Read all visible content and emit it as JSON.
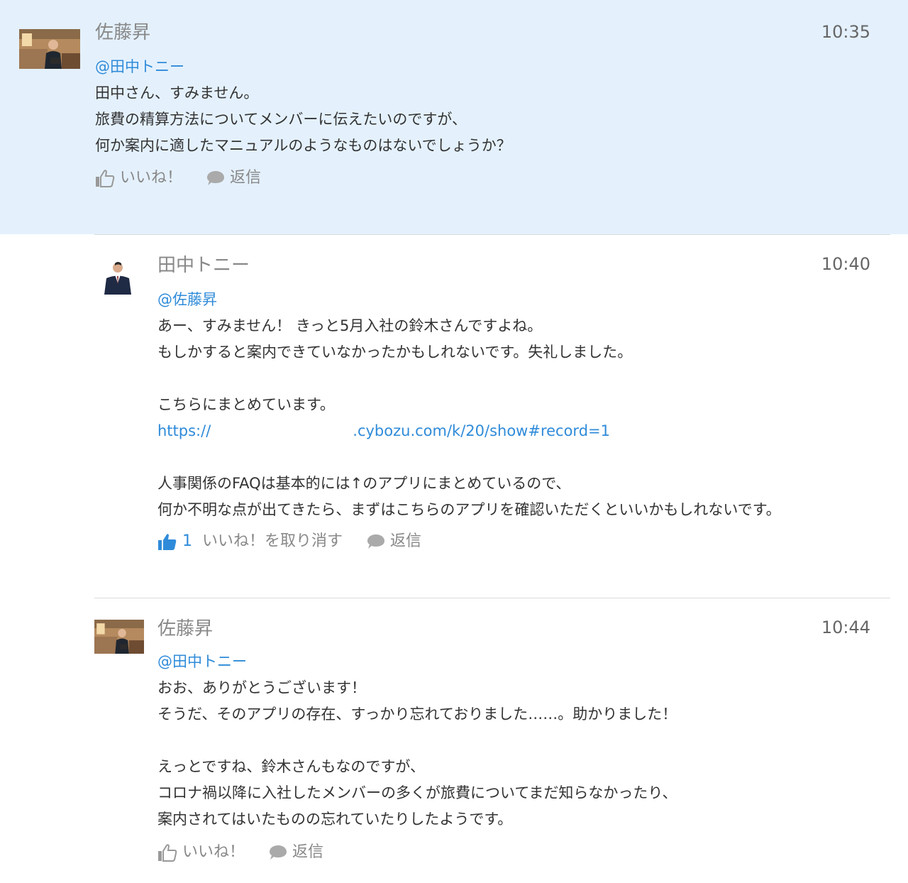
{
  "thread": {
    "root": {
      "author": "佐藤昇",
      "time": "10:35",
      "mention": "@田中トニー",
      "lines": [
        "田中さん、すみません。",
        "旅費の精算方法についてメンバーに伝えたいのですが、",
        "何か案内に適したマニュアルのようなものはないでしょうか？"
      ],
      "like_label": "いいね！",
      "reply_label": "返信"
    },
    "reply1": {
      "author": "田中トニー",
      "time": "10:40",
      "mention": "@佐藤昇",
      "lines_a": [
        "あー、すみません！ きっと5月入社の鈴木さんですよね。",
        "もしかすると案内できていなかったかもしれないです。失礼しました。",
        "",
        "こちらにまとめています。"
      ],
      "link_prefix": "https://",
      "link_suffix": ".cybozu.com/k/20/show#record=1",
      "lines_b": [
        "",
        "人事関係のFAQは基本的には↑のアプリにまとめているので、",
        "何か不明な点が出てきたら、まずはこちらのアプリを確認いただくといいかもしれないです。"
      ],
      "like_count": "1",
      "unlike_label": "いいね！を取り消す",
      "reply_label": "返信"
    },
    "reply2": {
      "author": "佐藤昇",
      "time": "10:44",
      "mention": "@田中トニー",
      "lines": [
        "おお、ありがとうございます！",
        "そうだ、そのアプリの存在、すっかり忘れておりました……。助かりました！",
        "",
        "えっとですね、鈴木さんもなのですが、",
        "コロナ禍以降に入社したメンバーの多くが旅費についてまだ知らなかったり、",
        "案内されてはいたものの忘れていたりしたようです。"
      ],
      "like_label": "いいね！",
      "reply_label": "返信"
    }
  },
  "colors": {
    "root_background": "#e4f1fd",
    "mention": "#2f8bd9",
    "muted": "#888888"
  },
  "icons": {
    "like": "thumbs-up-icon",
    "reply": "speech-bubble-icon"
  }
}
